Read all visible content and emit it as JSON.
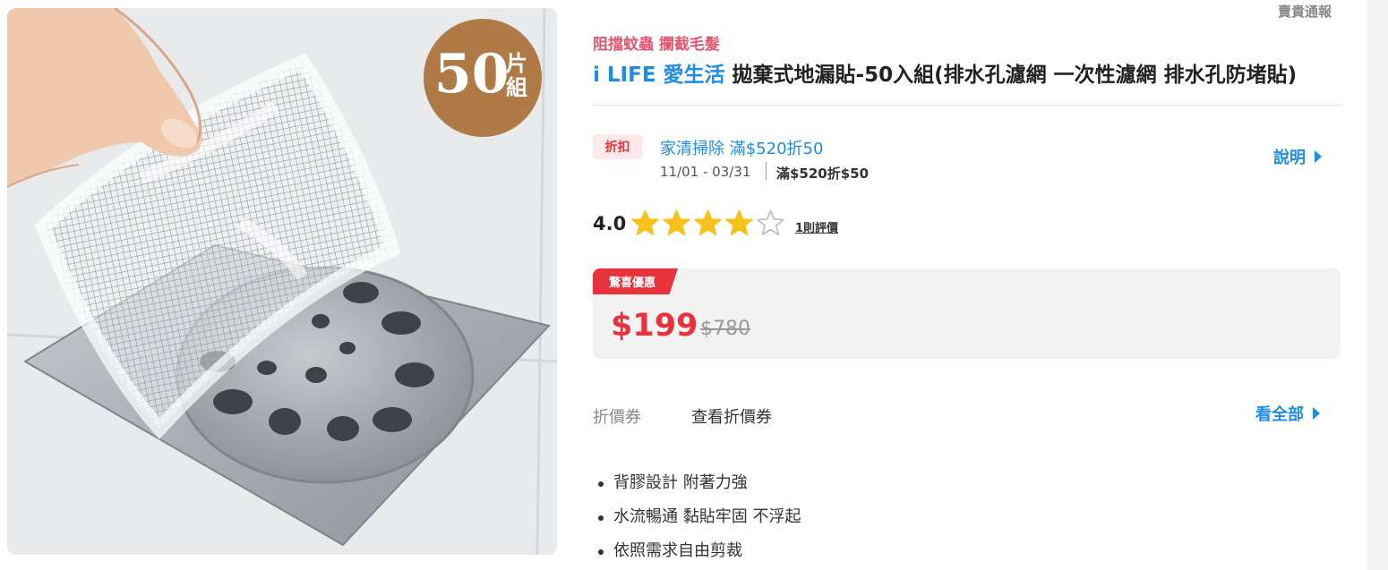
{
  "image": {
    "badge_number": "50",
    "badge_unit": "片組"
  },
  "report_link": "賣貴通報",
  "product": {
    "slogan": "阻擋蚊蟲 攔截毛髮",
    "brand": "i LIFE 愛生活",
    "title": " 拋棄式地漏貼-50入組(排水孔濾網 一次性濾網 排水孔防堵貼)"
  },
  "promotion": {
    "tag": "折扣",
    "name": "家清掃除 滿$520折50",
    "dates": "11/01 - 03/31",
    "rule": "滿$520折$50",
    "explain_label": "說明"
  },
  "rating": {
    "value": "4.0",
    "stars_filled": 4,
    "stars_total": 5,
    "reviews_label": "1則評價",
    "colors": {
      "filled": "#f8c21c",
      "empty": "#ffffff",
      "outline": "#bbbbbb"
    }
  },
  "price": {
    "tag": "驚喜優惠",
    "sale": "$199",
    "original": "$780"
  },
  "coupon": {
    "label": "折價券",
    "view": "查看折價券",
    "see_all": "看全部"
  },
  "features": [
    "背膠設計 附著力強",
    "水流暢通 黏貼牢固 不浮起",
    "依照需求自由剪裁"
  ],
  "colors": {
    "accent_blue": "#1f8ce6",
    "sale_red": "#e8323c",
    "slogan_pink": "#e8566d"
  }
}
